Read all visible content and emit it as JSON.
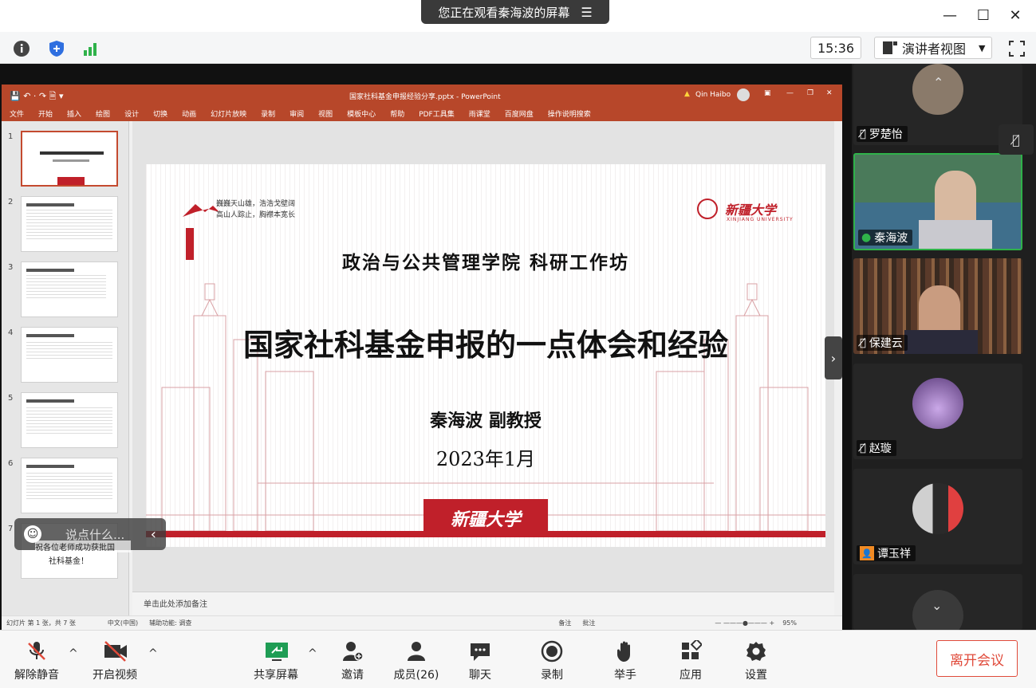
{
  "window": {
    "share_banner": "您正在观看秦海波的屏幕",
    "minimize": "—",
    "maximize": "☐",
    "close": "✕"
  },
  "toolbar": {
    "clock": "15:36",
    "view_mode": "演讲者视图"
  },
  "ppt": {
    "title": "国家社科基金申报经验分享.pptx  -  PowerPoint",
    "user": "Qin Haibo",
    "ribbon": [
      "文件",
      "开始",
      "插入",
      "绘图",
      "设计",
      "切换",
      "动画",
      "幻灯片放映",
      "录制",
      "审阅",
      "视图",
      "模板中心",
      "帮助",
      "PDF工具集",
      "雨课堂",
      "百度网盘",
      "操作说明搜索"
    ],
    "thumb_numbers": [
      "1",
      "2",
      "3",
      "4",
      "5",
      "6",
      "7"
    ],
    "thumb7_text": "社科基金！",
    "notes_placeholder": "单击此处添加备注",
    "status_left": "幻灯片 第 1 张，共 7 张",
    "status_lang": "中文(中国)",
    "status_access": "辅助功能: 调查",
    "status_notes": "备注",
    "status_comments": "批注",
    "zoom": "95%"
  },
  "slide": {
    "motto_line1": "巍巍天山雄，浩浩戈壁阔",
    "motto_line2": "高山人踪止，胸襟本宽长",
    "university_cn": "新疆大学",
    "university_en": "XINJIANG UNIVERSITY",
    "subtitle": "政治与公共管理学院 科研工作坊",
    "title": "国家社科基金申报的一点体会和经验",
    "author": "秦海波  副教授",
    "date": "2023年1月",
    "banner_text": "新疆大学"
  },
  "chat": {
    "placeholder": "说点什么...",
    "notice": "祝各位老师成功获批国"
  },
  "participants": [
    {
      "name": "罗楚怡",
      "mic": "muted"
    },
    {
      "name": "秦海波",
      "mic": "active"
    },
    {
      "name": "保建云",
      "mic": "muted"
    },
    {
      "name": "赵璇",
      "mic": "muted"
    },
    {
      "name": "谭玉祥",
      "mic": "none"
    }
  ],
  "bottombar": {
    "unmute": "解除静音",
    "video": "开启视频",
    "share": "共享屏幕",
    "invite": "邀请",
    "members": "成员(26)",
    "chat": "聊天",
    "record": "录制",
    "raise_hand": "举手",
    "apps": "应用",
    "settings": "设置",
    "leave": "离开会议"
  },
  "colors": {
    "ppt_red": "#b7472a",
    "slide_red": "#c0202a",
    "mic_green": "#2fb24a",
    "leave_red": "#e04a3a"
  }
}
